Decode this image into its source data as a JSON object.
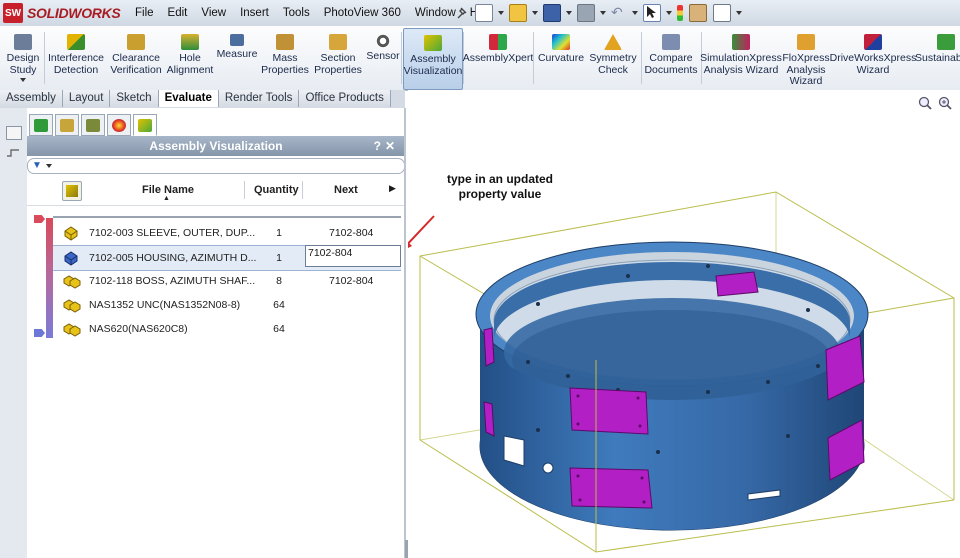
{
  "app": {
    "logo_text": "SOLIDWORKS",
    "logo_badge": "SW"
  },
  "menu": [
    "File",
    "Edit",
    "View",
    "Insert",
    "Tools",
    "PhotoView 360",
    "Window",
    "Help"
  ],
  "commands": [
    {
      "label": "Design Study",
      "icon": "design-study-icon"
    },
    {
      "label": "Interference Detection",
      "icon": "interference-icon"
    },
    {
      "label": "Clearance Verification",
      "icon": "clearance-icon"
    },
    {
      "label": "Hole Alignment",
      "icon": "hole-alignment-icon"
    },
    {
      "label": "Measure",
      "icon": "measure-icon"
    },
    {
      "label": "Mass Properties",
      "icon": "mass-properties-icon"
    },
    {
      "label": "Section Properties",
      "icon": "section-properties-icon"
    },
    {
      "label": "Sensor",
      "icon": "sensor-icon"
    },
    {
      "label": "Assembly Visualization",
      "icon": "assembly-visualization-icon",
      "active": true
    },
    {
      "label": "AssemblyXpert",
      "icon": "assemblyxpert-icon"
    },
    {
      "label": "Curvature",
      "icon": "curvature-icon"
    },
    {
      "label": "Symmetry Check",
      "icon": "symmetry-icon"
    },
    {
      "label": "Compare Documents",
      "icon": "compare-icon"
    },
    {
      "label": "SimulationXpress Analysis Wizard",
      "icon": "simulationxpress-icon"
    },
    {
      "label": "FloXpress Analysis Wizard",
      "icon": "floxpress-icon"
    },
    {
      "label": "DriveWorksXpress Wizard",
      "icon": "driveworksxpress-icon"
    },
    {
      "label": "Sustainab",
      "icon": "sustainability-icon"
    }
  ],
  "tabs": [
    {
      "label": "Assembly"
    },
    {
      "label": "Layout"
    },
    {
      "label": "Sketch"
    },
    {
      "label": "Evaluate",
      "active": true
    },
    {
      "label": "Render Tools"
    },
    {
      "label": "Office Products"
    }
  ],
  "panel": {
    "title": "Assembly Visualization",
    "help": "?",
    "close": "✕",
    "columns": {
      "file_name": "File Name",
      "quantity": "Quantity",
      "next": "Next"
    },
    "rows": [
      {
        "file_name": "7102-003 SLEEVE, OUTER, DUP...",
        "quantity": "1",
        "next": "7102-804"
      },
      {
        "file_name": "7102-005 HOUSING, AZIMUTH D...",
        "quantity": "1",
        "next": "7102-804",
        "editing": true
      },
      {
        "file_name": "7102-118 BOSS, AZIMUTH SHAF...",
        "quantity": "8",
        "next": "7102-804"
      },
      {
        "file_name": "NAS1352 UNC(NAS1352N08-8)",
        "quantity": "64",
        "next": ""
      },
      {
        "file_name": "NAS620(NAS620C8)",
        "quantity": "64",
        "next": ""
      }
    ]
  },
  "annotation": {
    "text": "type in an updated property value"
  },
  "colors": {
    "part_blue": "#3d78b8",
    "part_purple": "#b21fc4",
    "bbox": "#b9bd4a",
    "arrow": "#d42a2a"
  }
}
